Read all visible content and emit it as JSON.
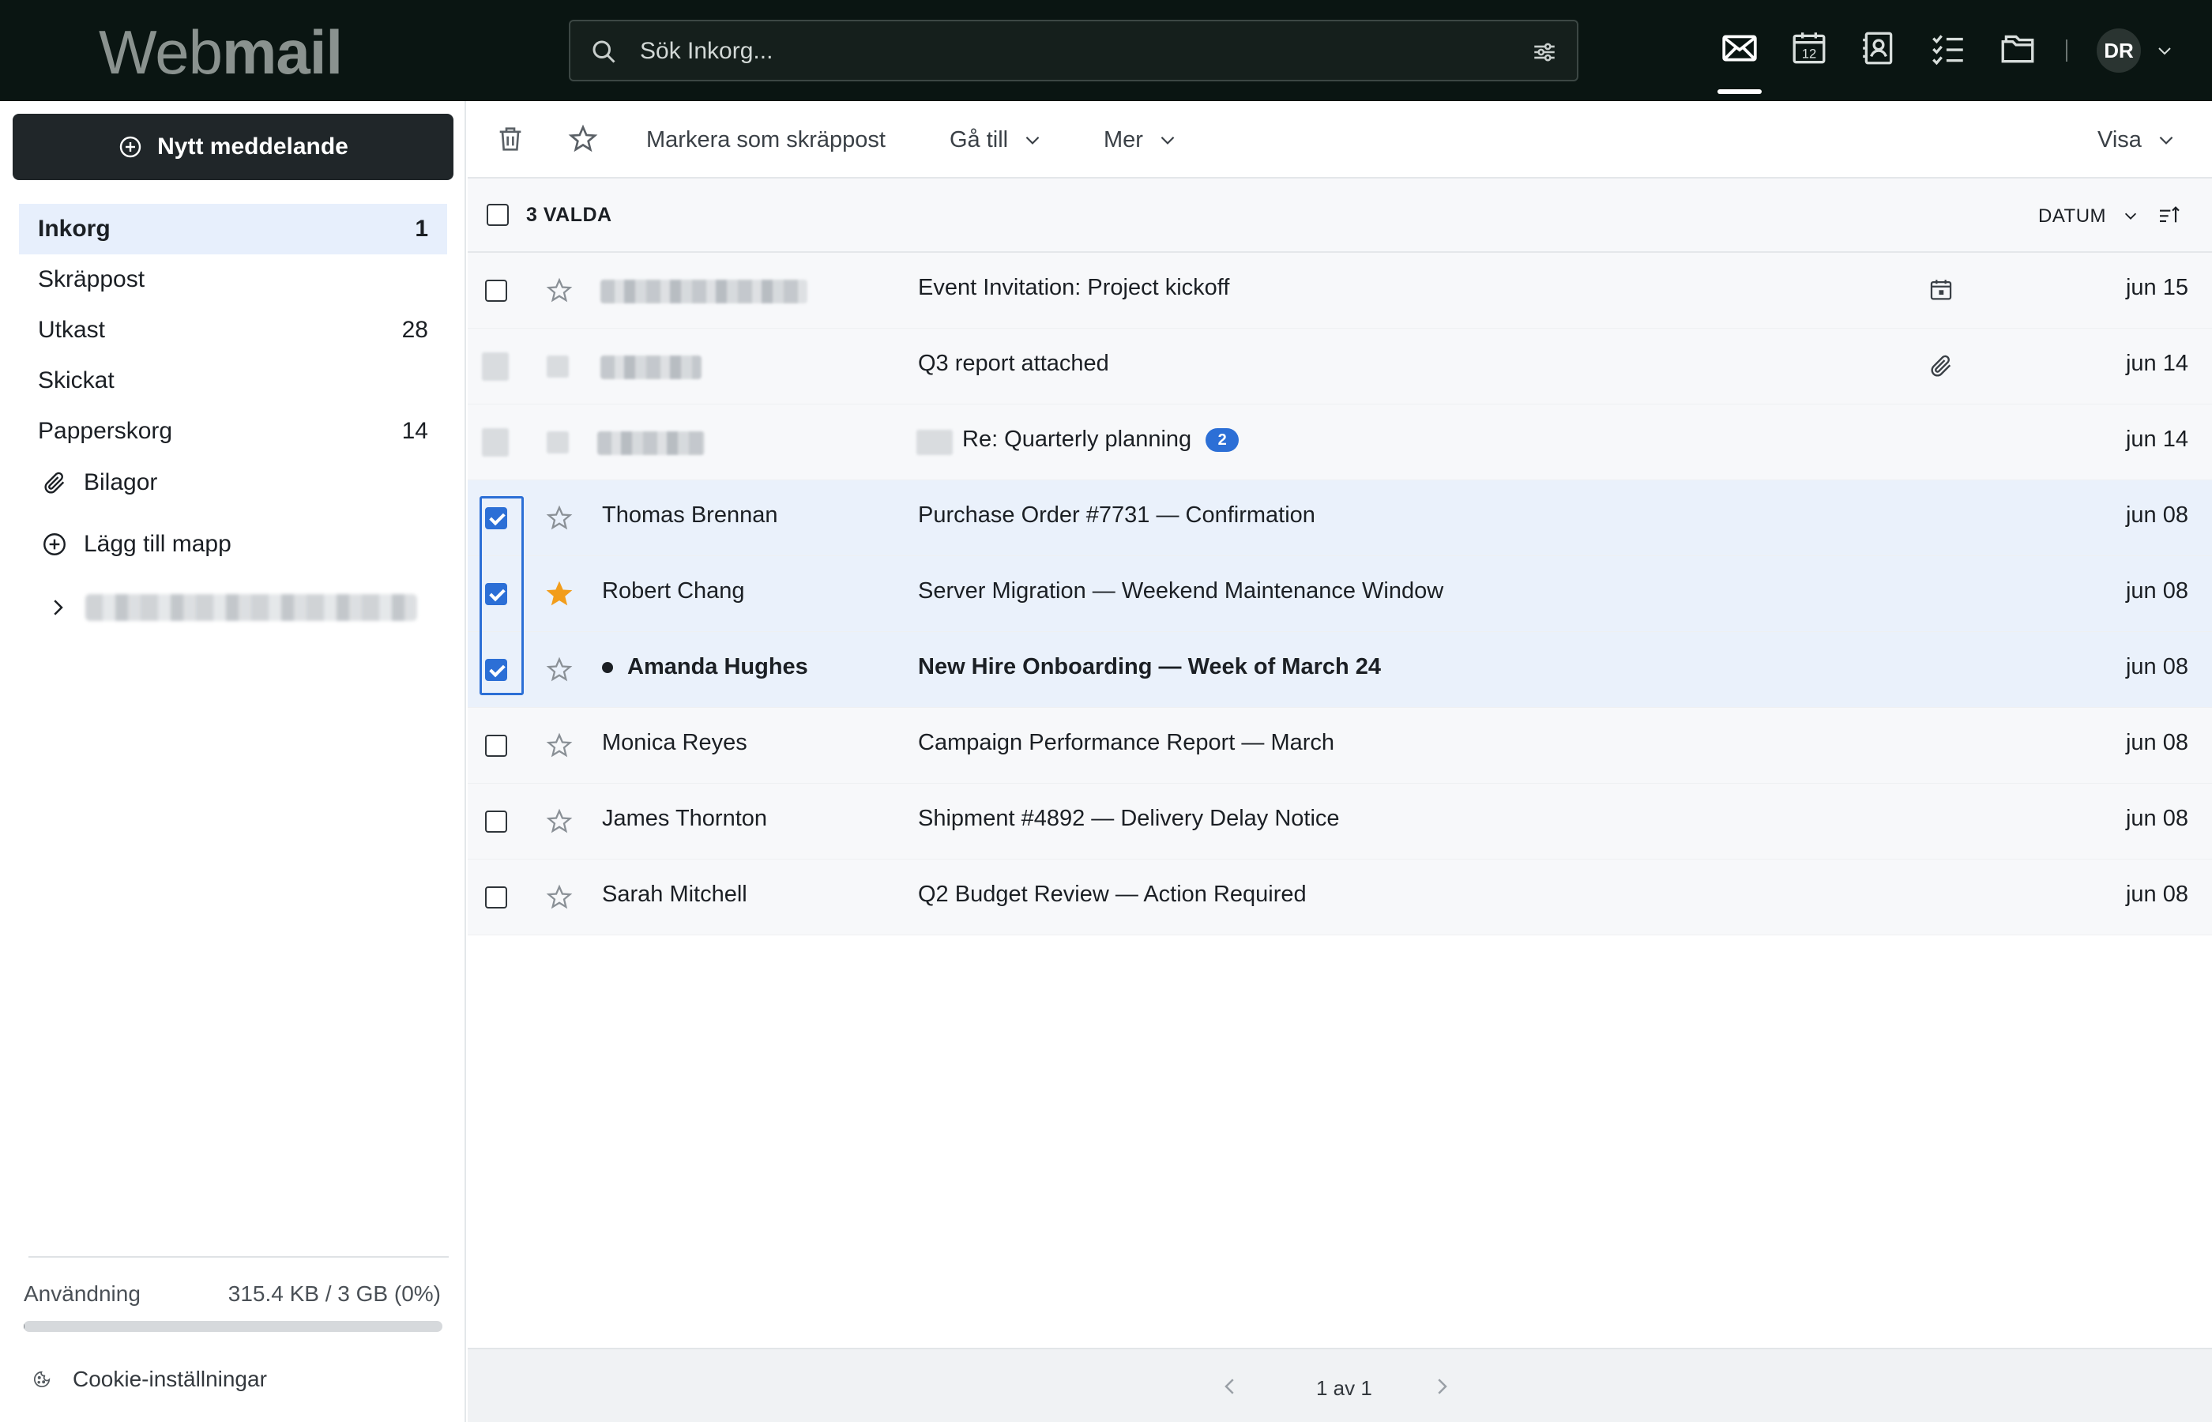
{
  "app": {
    "logo_light": "Web",
    "logo_bold": "mail"
  },
  "search": {
    "placeholder": "Sök Inkorg..."
  },
  "topnav": {
    "icons": [
      "mail-icon",
      "calendar-icon",
      "contacts-icon",
      "tasks-icon",
      "files-icon"
    ],
    "calendar_day": "12",
    "avatar_initials": "DR"
  },
  "sidebar": {
    "compose_label": "Nytt meddelande",
    "folders": [
      {
        "label": "Inkorg",
        "count": "1",
        "active": true
      },
      {
        "label": "Skräppost",
        "count": ""
      },
      {
        "label": "Utkast",
        "count": "28"
      },
      {
        "label": "Skickat",
        "count": ""
      },
      {
        "label": "Papperskorg",
        "count": "14"
      }
    ],
    "attachments_label": "Bilagor",
    "add_folder_label": "Lägg till mapp",
    "usage_label": "Användning",
    "usage_value": "315.4 KB / 3 GB (0%)",
    "usage_fraction": 0.001,
    "cookie_label": "Cookie-inställningar"
  },
  "toolbar": {
    "spam_label": "Markera som skräppost",
    "goto_label": "Gå till",
    "more_label": "Mer",
    "view_label": "Visa"
  },
  "listhead": {
    "selected_label": "3 VALDA",
    "sort_label": "DATUM"
  },
  "messages": [
    {
      "sender": "",
      "subject": "Event Invitation: Project kickoff",
      "date": "jun 15",
      "icon": "calendar-icon"
    },
    {
      "sender": "",
      "subject": "Q3 report attached",
      "date": "jun 14",
      "icon": "paperclip-icon"
    },
    {
      "sender": "",
      "subject": "Re: Quarterly planning",
      "badge": "2",
      "date": "jun 14"
    },
    {
      "sender": "Thomas Brennan",
      "subject": "Purchase Order #7731 — Confirmation",
      "date": "jun 08",
      "checked": true
    },
    {
      "sender": "Robert Chang",
      "subject": "Server Migration — Weekend Maintenance Window",
      "date": "jun 08",
      "checked": true,
      "starred": true
    },
    {
      "sender": "Amanda Hughes",
      "subject": "New Hire Onboarding — Week of March 24",
      "date": "jun 08",
      "checked": true,
      "unread": true
    },
    {
      "sender": "Monica Reyes",
      "subject": "Campaign Performance Report — March",
      "date": "jun 08"
    },
    {
      "sender": "James Thornton",
      "subject": "Shipment #4892 — Delivery Delay Notice",
      "date": "jun 08"
    },
    {
      "sender": "Sarah Mitchell",
      "subject": "Q2 Budget Review — Action Required",
      "date": "jun 08"
    }
  ],
  "pager": {
    "label": "1 av 1"
  },
  "colors": {
    "accent": "#2c6fd6",
    "star": "#f29d1b",
    "topbar": "#0a1512",
    "selected_row": "#eaf1fb"
  }
}
